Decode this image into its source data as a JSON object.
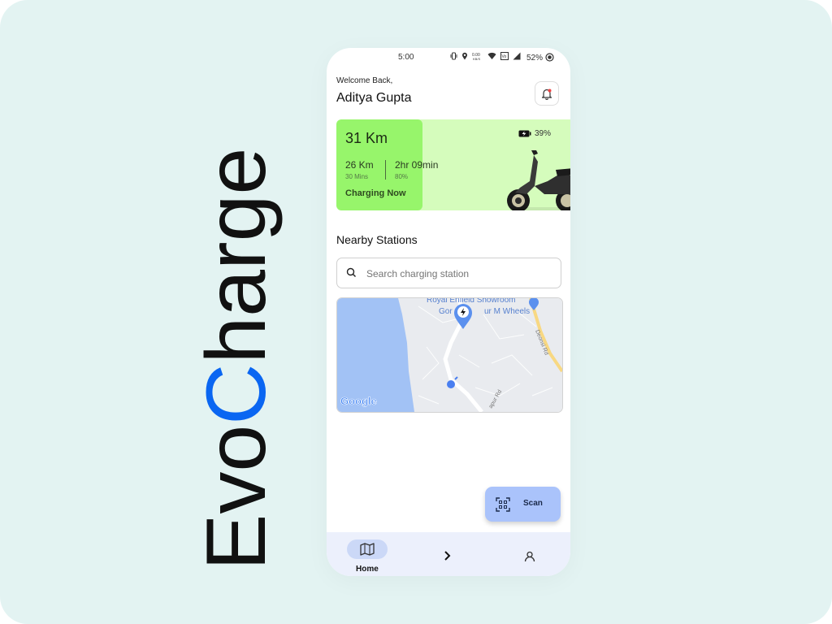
{
  "brand": {
    "title_prefix": "Evo",
    "title_accent": "C",
    "title_suffix": "harge",
    "accent_color": "#0a66f2",
    "text_color": "#111111"
  },
  "status_bar": {
    "time": "5:00",
    "net_speed": "0.00 KB/S",
    "battery": "52%",
    "icons": [
      "vibrate-icon",
      "location-icon",
      "wifi-icon",
      "volte-icon",
      "signal-icon",
      "battery-saver-icon"
    ]
  },
  "header": {
    "welcome": "Welcome Back,",
    "user_name": "Aditya Gupta",
    "notification_icon": "bell-icon"
  },
  "vehicle_card": {
    "range": "31 Km",
    "metric1_value": "26 Km",
    "metric1_sub": "30 Mins",
    "metric2_value": "2hr 09min",
    "metric2_sub": "80%",
    "status": "Charging Now",
    "battery_level": "39%",
    "colors": {
      "light": "#d5fcbc",
      "accent": "#97f56b"
    }
  },
  "nearby": {
    "title": "Nearby Stations",
    "search_placeholder": "Search charging station"
  },
  "map": {
    "labels": {
      "poi1": "Royal Enfield Showroom",
      "poi2": "Gor",
      "poi3": "ur M Wheels",
      "road1": "Deonsi Rd",
      "road2": "apur Rd",
      "logo": "Google"
    },
    "colors": {
      "water": "#a2c2f5",
      "land": "#e9ebef",
      "highway": "#f8d882",
      "pin": "#5b90ee"
    }
  },
  "scan_button": {
    "label": "Scan",
    "icon": "qr-scan-icon"
  },
  "bottom_nav": {
    "home_label": "Home",
    "items": [
      "map-icon",
      "chevron-right-icon",
      "profile-icon"
    ]
  }
}
